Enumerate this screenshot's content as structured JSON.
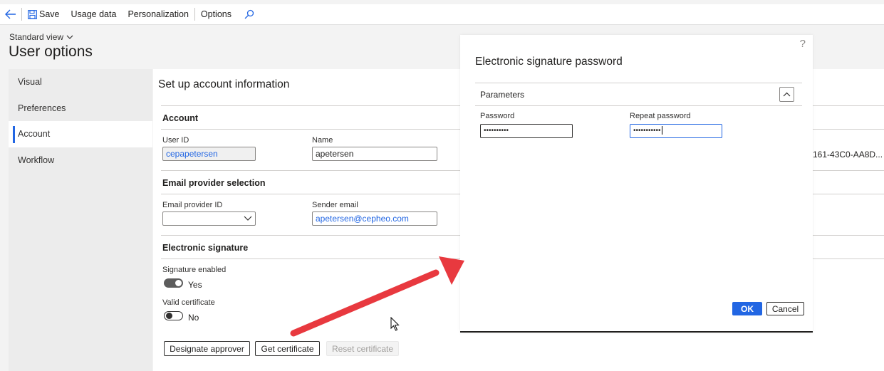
{
  "actionpane": {
    "save": "Save",
    "usage_data": "Usage data",
    "personalization": "Personalization",
    "options": "Options"
  },
  "header": {
    "view": "Standard view",
    "title": "User options"
  },
  "tabs": [
    {
      "label": "Visual"
    },
    {
      "label": "Preferences"
    },
    {
      "label": "Account"
    },
    {
      "label": "Workflow"
    }
  ],
  "content": {
    "title": "Set up account information",
    "account": {
      "header": "Account",
      "user_id_label": "User ID",
      "user_id_value": "cepapetersen",
      "name_label": "Name",
      "name_value": "apetersen",
      "truncated_value": "161-43C0-AA8D..."
    },
    "email": {
      "header": "Email provider selection",
      "provider_label": "Email provider ID",
      "provider_value": "",
      "sender_label": "Sender email",
      "sender_value": "apetersen@cepheo.com"
    },
    "signature": {
      "header": "Electronic signature",
      "enabled_label": "Signature enabled",
      "enabled_value": "Yes",
      "certificate_label": "Valid certificate",
      "certificate_value": "No",
      "designate_button": "Designate approver",
      "get_cert_button": "Get certificate",
      "reset_cert_button": "Reset certificate"
    }
  },
  "dialog": {
    "help": "?",
    "title": "Electronic signature password",
    "section": "Parameters",
    "password_label": "Password",
    "password_value": "••••••••••",
    "repeat_label": "Repeat password",
    "repeat_value": "•••••••••••",
    "ok": "OK",
    "cancel": "Cancel"
  },
  "colors": {
    "accent": "#2266e3",
    "annotation_arrow": "#e8393f"
  }
}
